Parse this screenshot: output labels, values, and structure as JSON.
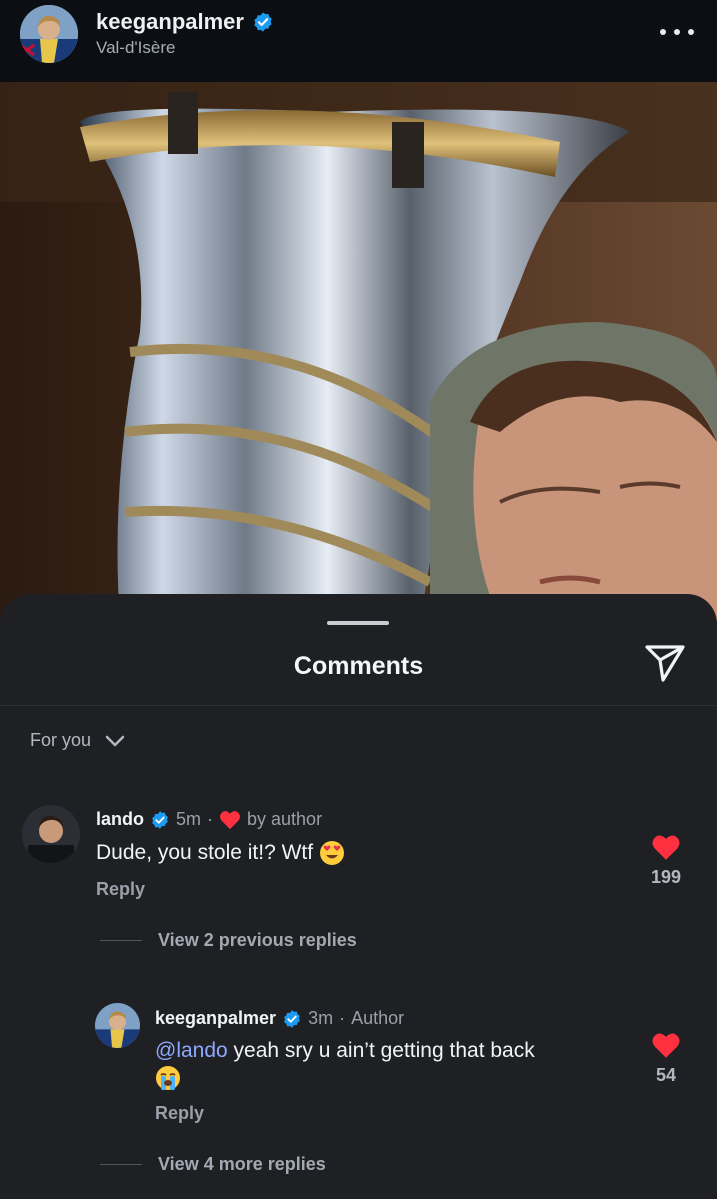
{
  "header": {
    "username": "keeganpalmer",
    "location": "Val-d'Isère",
    "verified_icon": "verified-badge-icon",
    "more_icon": "more-options-icon"
  },
  "sheet": {
    "title": "Comments",
    "share_icon": "send-icon",
    "sort_label": "For you"
  },
  "comments": [
    {
      "username": "lando",
      "time": "5m",
      "liked_by_author_label": "by author",
      "text": "Dude, you stole it!? Wtf",
      "emoji": "heart-eyes-emoji",
      "reply_label": "Reply",
      "likes": "199",
      "view_replies_label": "View 2 previous replies"
    },
    {
      "username": "keeganpalmer",
      "time": "3m",
      "role": "Author",
      "mention": "@lando",
      "text": " yeah sry u ain’t getting that back",
      "emoji": "crying-emoji",
      "reply_label": "Reply",
      "likes": "54",
      "view_replies_label": "View 4 more replies"
    }
  ],
  "colors": {
    "sheet_bg": "#1f2024",
    "verified": "#1d9bf0",
    "like_red": "#ff3040",
    "mention": "#8fa8ff"
  }
}
